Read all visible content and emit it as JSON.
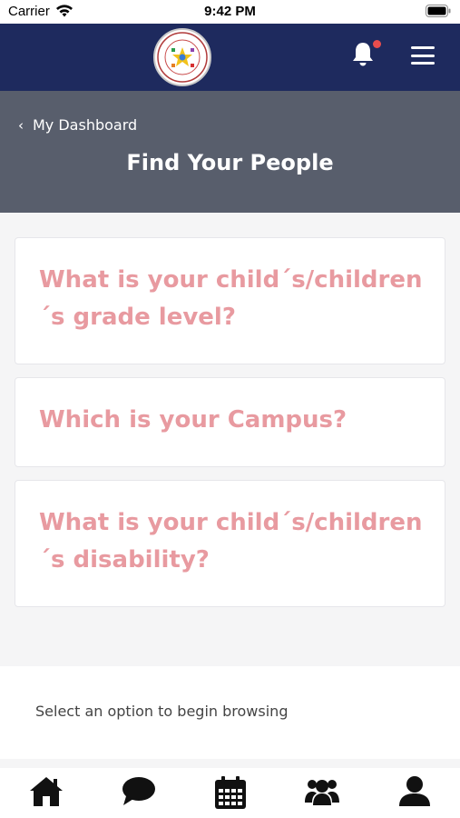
{
  "status_bar": {
    "carrier": "Carrier",
    "time": "9:42 PM"
  },
  "top_bar": {
    "logo": "school-seal-logo",
    "notification_dot_color": "#e84d4d"
  },
  "header": {
    "back_label": "My Dashboard",
    "title": "Find Your People"
  },
  "cards": [
    {
      "text": "What is your child´s/children ´s grade level?"
    },
    {
      "text": "Which is your Campus?"
    },
    {
      "text": "What is your child´s/children ´s disability?"
    }
  ],
  "browse": {
    "hint": "Select an option to begin browsing"
  },
  "tab_bar": {
    "items": [
      {
        "icon": "home-icon"
      },
      {
        "icon": "chat-icon"
      },
      {
        "icon": "calendar-icon"
      },
      {
        "icon": "group-icon"
      },
      {
        "icon": "profile-icon"
      }
    ]
  },
  "colors": {
    "nav": "#1e2a5e",
    "header": "#585e6c",
    "card_text": "#e89aa0"
  }
}
